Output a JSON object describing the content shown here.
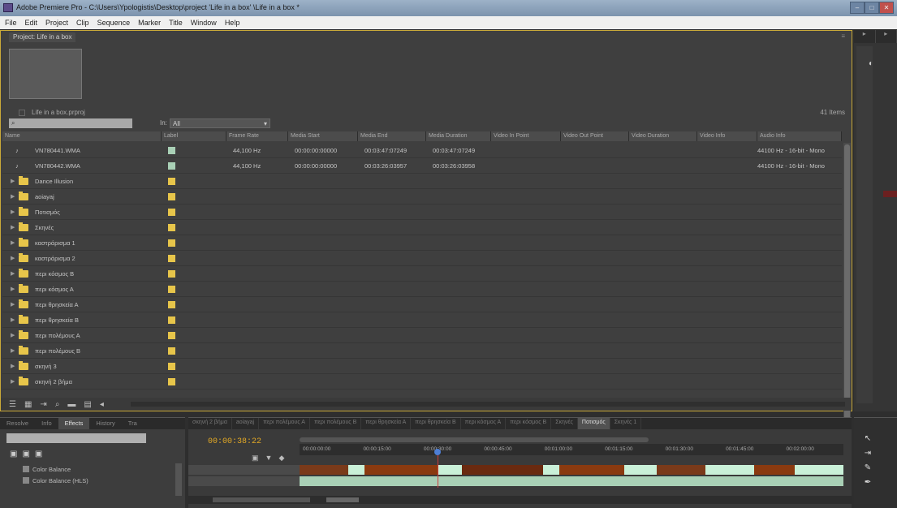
{
  "window": {
    "title": "Adobe Premiere Pro - C:\\Users\\Ypologistis\\Desktop\\project 'Life in a box' \\Life in a box *",
    "controls": [
      "–",
      "□",
      "✕"
    ]
  },
  "menu": [
    "File",
    "Edit",
    "Project",
    "Clip",
    "Sequence",
    "Marker",
    "Title",
    "Window",
    "Help"
  ],
  "project_panel": {
    "tab": "Project: Life in a box",
    "file": "Life in a box.prproj",
    "items_count": "41 Items",
    "search_placeholder": "",
    "in_label": "In:",
    "in_value": "All",
    "columns": [
      "Name",
      "Label",
      "Frame Rate",
      "Media Start",
      "Media End",
      "Media Duration",
      "Video In Point",
      "Video Out Point",
      "Video Duration",
      "Video Info",
      "Audio Info"
    ],
    "rows": [
      {
        "type": "clip",
        "name": "VN780441.WMA",
        "label_color": "#a9d0b6",
        "c1": "44,100 Hz",
        "c2": "00:00:00:00000",
        "c3": "00:03:47:07249",
        "c4": "00:03:47:07249",
        "c5": "44100 Hz - 16-bit - Mono"
      },
      {
        "type": "clip",
        "name": "VN780442.WMA",
        "label_color": "#a9d0b6",
        "c1": "44,100 Hz",
        "c2": "00:00:00:00000",
        "c3": "00:03:26:03957",
        "c4": "00:03:26:03958",
        "c5": "44100 Hz - 16-bit - Mono"
      },
      {
        "type": "folder",
        "name": "Dance Illusion",
        "label_color": "#e7c54a",
        "c1": "",
        "c2": "",
        "c3": "",
        "c4": "",
        "c5": ""
      },
      {
        "type": "folder",
        "name": "aoiayaj",
        "label_color": "#e7c54a",
        "c1": "",
        "c2": "",
        "c3": "",
        "c4": "",
        "c5": ""
      },
      {
        "type": "folder",
        "name": "Ποτισμός",
        "label_color": "#e7c54a",
        "c1": "",
        "c2": "",
        "c3": "",
        "c4": "",
        "c5": ""
      },
      {
        "type": "folder",
        "name": "Σκηνές",
        "label_color": "#e7c54a",
        "c1": "",
        "c2": "",
        "c3": "",
        "c4": "",
        "c5": ""
      },
      {
        "type": "folder",
        "name": "καστράρισμα 1",
        "label_color": "#e7c54a",
        "c1": "",
        "c2": "",
        "c3": "",
        "c4": "",
        "c5": ""
      },
      {
        "type": "folder",
        "name": "καστράρισμα 2",
        "label_color": "#e7c54a",
        "c1": "",
        "c2": "",
        "c3": "",
        "c4": "",
        "c5": ""
      },
      {
        "type": "folder",
        "name": "περι κόσμος Β",
        "label_color": "#e7c54a",
        "c1": "",
        "c2": "",
        "c3": "",
        "c4": "",
        "c5": ""
      },
      {
        "type": "folder",
        "name": "περι κόσμος Α",
        "label_color": "#e7c54a",
        "c1": "",
        "c2": "",
        "c3": "",
        "c4": "",
        "c5": ""
      },
      {
        "type": "folder",
        "name": "περι θρησκεία Α",
        "label_color": "#e7c54a",
        "c1": "",
        "c2": "",
        "c3": "",
        "c4": "",
        "c5": ""
      },
      {
        "type": "folder",
        "name": "περι θρησκεία Β",
        "label_color": "#e7c54a",
        "c1": "",
        "c2": "",
        "c3": "",
        "c4": "",
        "c5": ""
      },
      {
        "type": "folder",
        "name": "περι πολέμους Α",
        "label_color": "#e7c54a",
        "c1": "",
        "c2": "",
        "c3": "",
        "c4": "",
        "c5": ""
      },
      {
        "type": "folder",
        "name": "περι πολέμους Β",
        "label_color": "#e7c54a",
        "c1": "",
        "c2": "",
        "c3": "",
        "c4": "",
        "c5": ""
      },
      {
        "type": "folder",
        "name": "σκηνή 3",
        "label_color": "#e7c54a",
        "c1": "",
        "c2": "",
        "c3": "",
        "c4": "",
        "c5": ""
      },
      {
        "type": "folder",
        "name": "σκηνή 2 βήμα",
        "label_color": "#e7c54a",
        "c1": "",
        "c2": "",
        "c3": "",
        "c4": "",
        "c5": ""
      }
    ]
  },
  "effects_panel": {
    "tabs": [
      "Resolve",
      "Info",
      "Effects",
      "History",
      "Tra"
    ],
    "active_tab": "Effects",
    "items": [
      "Color Balance",
      "Color Balance (HLS)"
    ]
  },
  "timeline": {
    "tabs": [
      "σκηνή 2 βήμα",
      "aoiayaj",
      "περι πολέμους Α",
      "περι πολέμους Β",
      "περι θρησκεία Α",
      "περι θρησκεία Β",
      "περι κόσμος Α",
      "περι κόσμος Β",
      "Σκηνές",
      "Ποτισμός",
      "Σκηνές 1"
    ],
    "active_tab": "Ποτισμός",
    "timecode": "00:00:38:22",
    "ruler": [
      "00:00:00:00",
      "00:00:15:00",
      "00:00:30:00",
      "00:00:45:00",
      "00:01:00:00",
      "00:01:15:00",
      "00:01:30:00",
      "00:01:45:00",
      "00:02:00:00"
    ]
  },
  "colors": {
    "accent": "#e2a825",
    "folder": "#e7c54a",
    "panel_highlight": "#c9a938"
  }
}
